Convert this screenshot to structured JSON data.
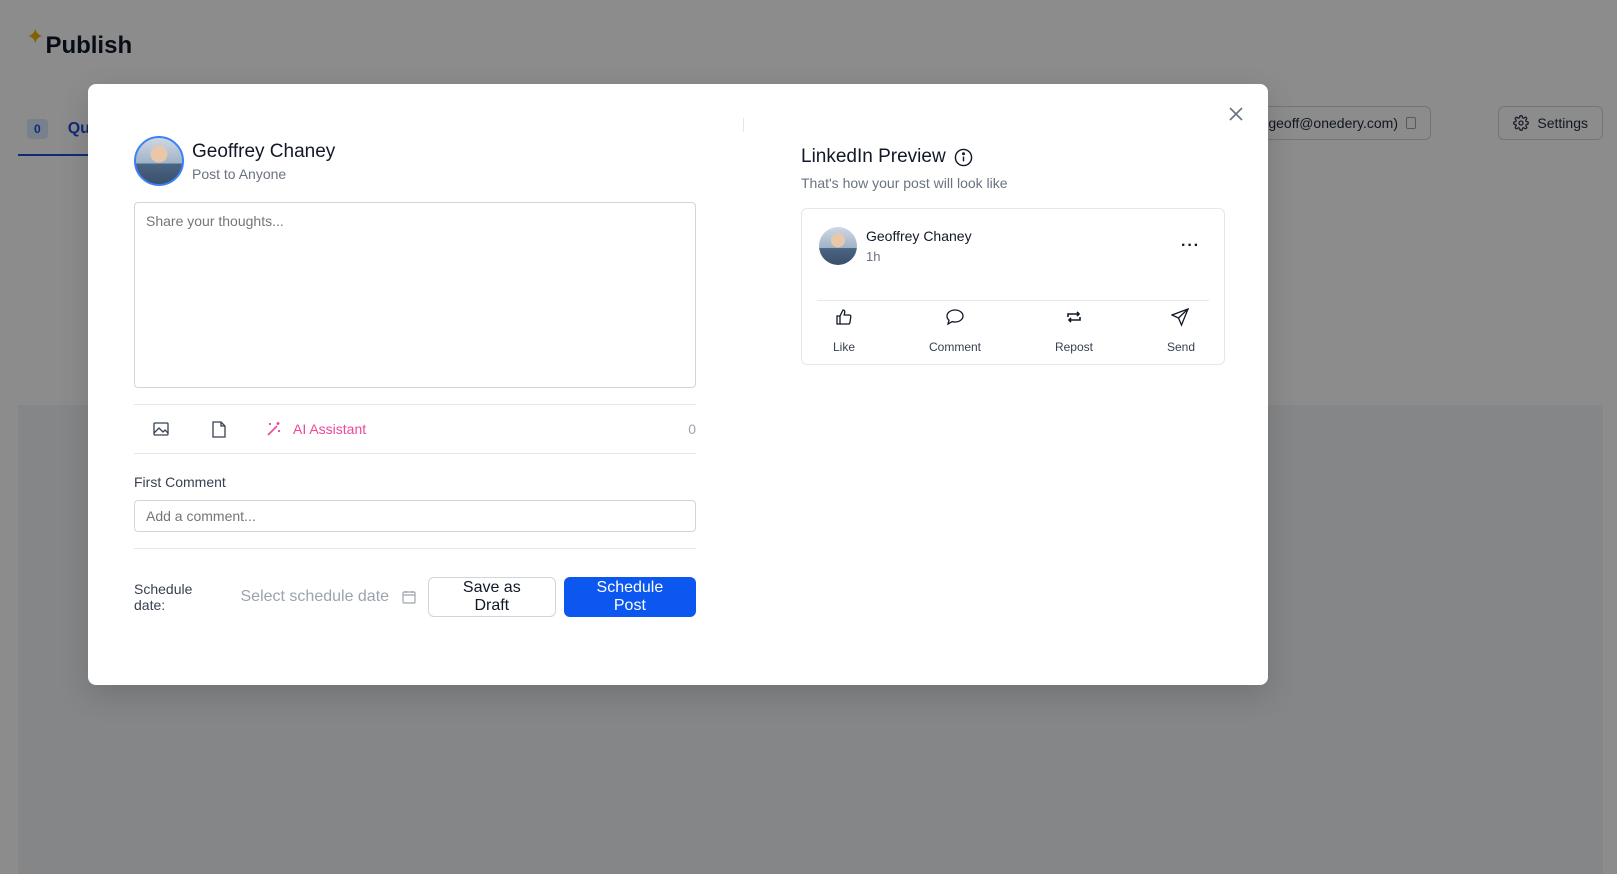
{
  "app": {
    "title": "Publish",
    "tab_count": "0",
    "tab_label": "Qu",
    "account_label": "y Chaney (geoff@onedery.com)",
    "settings_label": "Settings"
  },
  "composer": {
    "author_name": "Geoffrey Chaney",
    "author_sub": "Post to Anyone",
    "post_placeholder": "Share your thoughts...",
    "ai_assistant_label": "AI Assistant",
    "char_count": "0",
    "first_comment_label": "First Comment",
    "first_comment_placeholder": "Add a comment...",
    "schedule_label": "Schedule date:",
    "schedule_placeholder": "Select schedule date",
    "save_draft_label": "Save as Draft",
    "schedule_post_label": "Schedule Post"
  },
  "preview": {
    "title": "LinkedIn Preview",
    "subtitle": "That's how your post will look like",
    "card": {
      "name": "Geoffrey Chaney",
      "time": "1h",
      "more": "···",
      "actions": {
        "like": "Like",
        "comment": "Comment",
        "repost": "Repost",
        "send": "Send"
      }
    }
  },
  "colors": {
    "primary": "#0b57f0",
    "ai_accent": "#ec4899",
    "tab_accent": "#1d4ed8",
    "overlay": "rgba(0,0,0,0.45)"
  },
  "icons": {
    "close": "close-icon",
    "image": "image-icon",
    "document": "document-icon",
    "ai": "magic-wand-icon",
    "calendar": "calendar-icon",
    "info": "info-icon",
    "like": "thumbs-up-icon",
    "comment": "comment-icon",
    "repost": "repost-icon",
    "send": "send-icon",
    "settings": "gear-icon"
  }
}
